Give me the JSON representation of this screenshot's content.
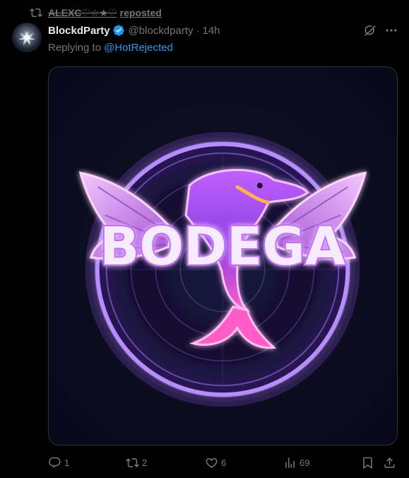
{
  "repost": {
    "name": "ALEXC♡☆★♡",
    "label": "reposted"
  },
  "author": {
    "display_name": "BlockdParty",
    "handle": "@blockdparty",
    "time": "14h",
    "verified": true
  },
  "reply": {
    "prefix": "Replying to",
    "mention": "@HotRejected"
  },
  "media": {
    "logo_text": "BODEGA"
  },
  "actions": {
    "replies": "1",
    "reposts": "2",
    "likes": "6",
    "views": "69"
  },
  "colors": {
    "accent": "#1d9bf0",
    "muted": "#71767b",
    "text": "#e7e9ea",
    "background": "#000000"
  },
  "icons": [
    "repost-icon",
    "verified-badge-icon",
    "grok-icon",
    "more-icon",
    "reply-icon",
    "like-icon",
    "views-icon",
    "bookmark-icon",
    "share-icon"
  ]
}
